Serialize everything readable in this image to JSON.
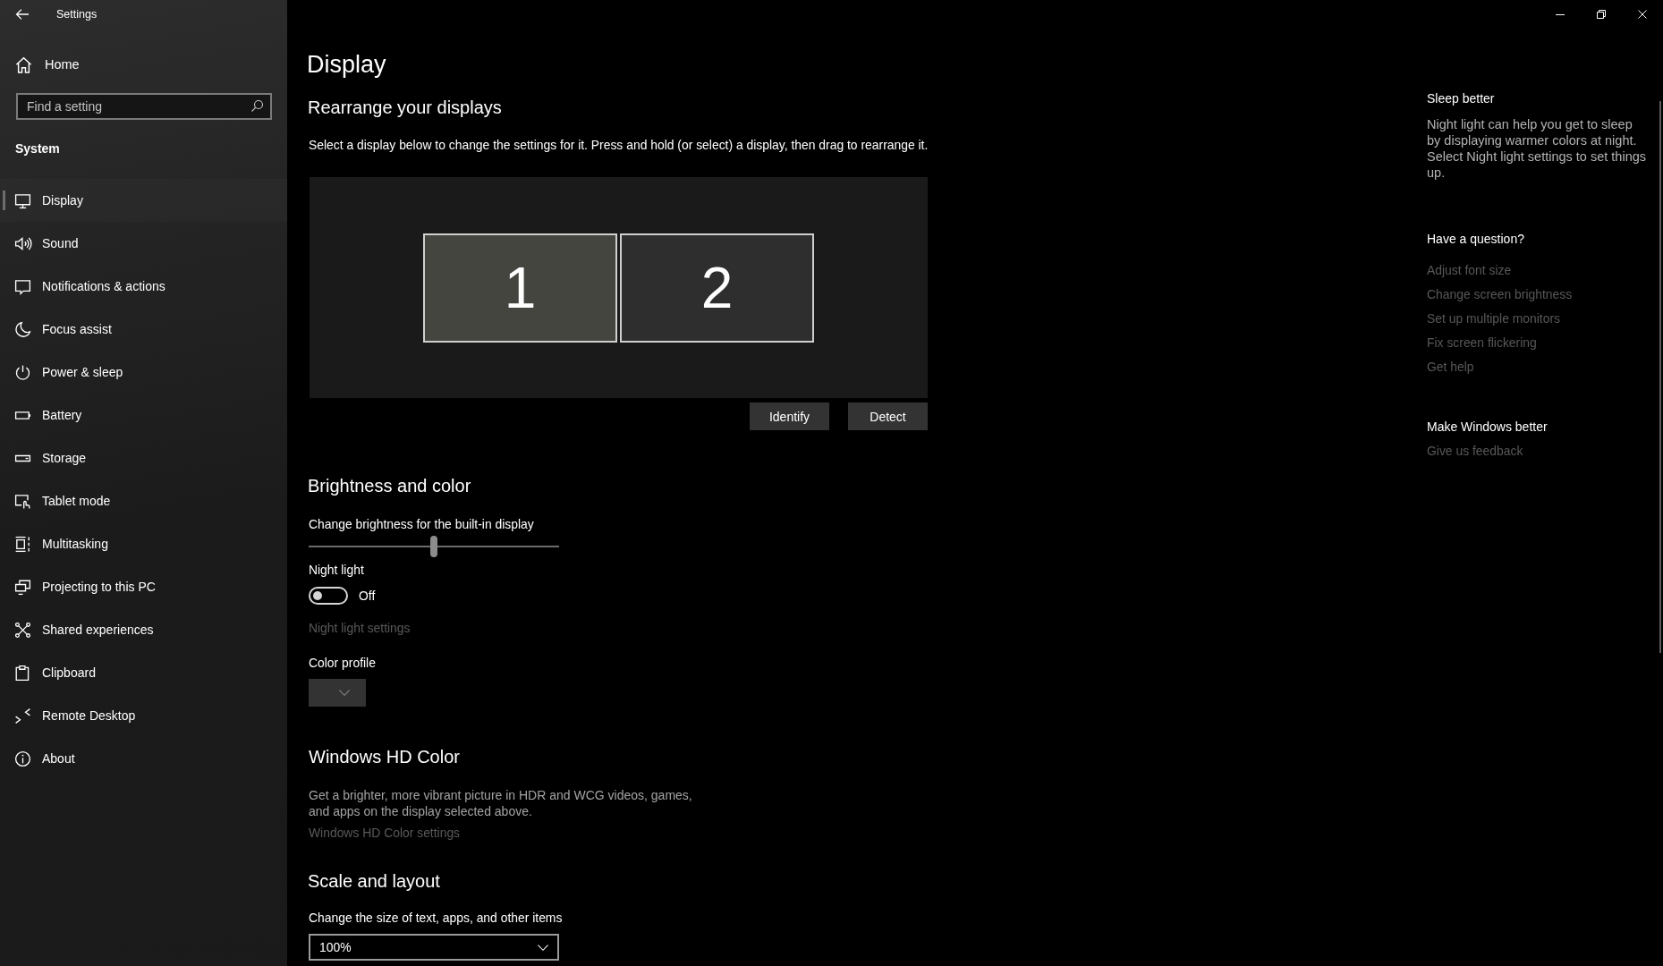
{
  "window": {
    "title": "Settings"
  },
  "sidebar": {
    "home": "Home",
    "search": {
      "placeholder": "Find a setting"
    },
    "section": "System",
    "items": [
      {
        "label": "Display",
        "selected": true
      },
      {
        "label": "Sound",
        "selected": false
      },
      {
        "label": "Notifications & actions",
        "selected": false
      },
      {
        "label": "Focus assist",
        "selected": false
      },
      {
        "label": "Power & sleep",
        "selected": false
      },
      {
        "label": "Battery",
        "selected": false
      },
      {
        "label": "Storage",
        "selected": false
      },
      {
        "label": "Tablet mode",
        "selected": false
      },
      {
        "label": "Multitasking",
        "selected": false
      },
      {
        "label": "Projecting to this PC",
        "selected": false
      },
      {
        "label": "Shared experiences",
        "selected": false
      },
      {
        "label": "Clipboard",
        "selected": false
      },
      {
        "label": "Remote Desktop",
        "selected": false
      },
      {
        "label": "About",
        "selected": false
      }
    ]
  },
  "page": {
    "title": "Display"
  },
  "rearrange": {
    "heading": "Rearrange your displays",
    "description": "Select a display below to change the settings for it. Press and hold (or select) a display, then drag to rearrange it.",
    "monitors": [
      {
        "label": "1",
        "selected": true
      },
      {
        "label": "2",
        "selected": false
      }
    ],
    "buttons": [
      "Identify",
      "Detect"
    ]
  },
  "brightness": {
    "heading": "Brightness and color",
    "slider": {
      "label": "Change brightness for the built-in display",
      "level": 0.5
    },
    "night_light": {
      "label": "Night light",
      "on": false,
      "state_text": "Off"
    },
    "night_light_link": {
      "text": "Night light settings",
      "disabled": true
    },
    "color_profile": {
      "label": "Color profile",
      "disabled": true
    }
  },
  "hd_color": {
    "heading": "Windows HD Color",
    "description": "Get a brighter, more vibrant picture in HDR and WCG videos, games, and apps on the display selected above.",
    "link": {
      "text": "Windows HD Color settings",
      "disabled": true
    }
  },
  "scale": {
    "heading": "Scale and layout",
    "label": "Change the size of text, apps, and other items",
    "value": "100%"
  },
  "related": {
    "sleep": {
      "heading": "Sleep better",
      "text": "Night light can help you get to sleep by displaying warmer colors at night. Select Night light settings to set things up."
    },
    "question": {
      "heading": "Have a question?",
      "links": [
        {
          "text": "Adjust font size",
          "disabled": true
        },
        {
          "text": "Change screen brightness",
          "disabled": true
        },
        {
          "text": "Set up multiple monitors",
          "disabled": true
        },
        {
          "text": "Fix screen flickering",
          "disabled": true
        },
        {
          "text": "Get help",
          "disabled": true
        }
      ]
    },
    "feedback": {
      "heading": "Make Windows better",
      "links": [
        {
          "text": "Give us feedback",
          "disabled": true
        }
      ]
    }
  }
}
